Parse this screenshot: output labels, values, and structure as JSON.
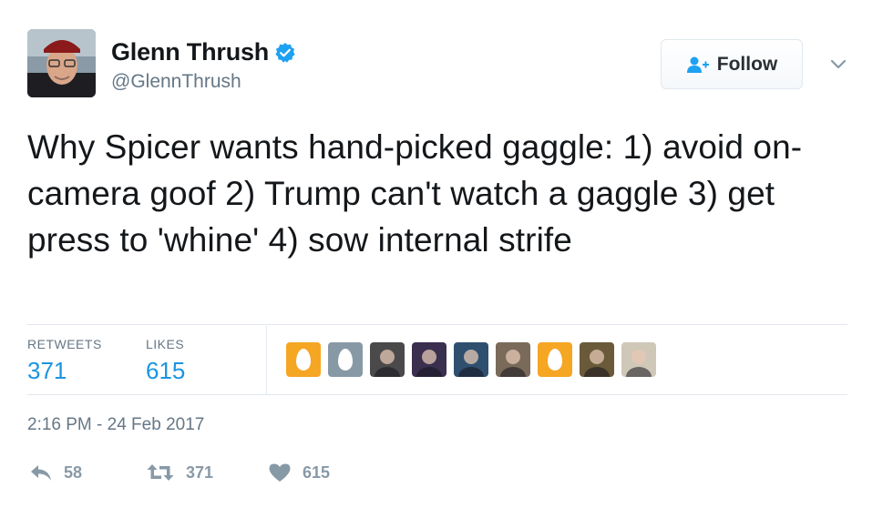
{
  "author": {
    "display_name": "Glenn Thrush",
    "handle": "@GlennThrush"
  },
  "follow_button": {
    "label": "Follow"
  },
  "tweet": {
    "text": "Why Spicer wants hand-picked gaggle: 1) avoid on-camera goof 2) Trump can't watch a gaggle 3) get press to 'whine' 4) sow internal strife",
    "timestamp": "2:16 PM - 24 Feb 2017"
  },
  "stats": {
    "retweets_label": "RETWEETS",
    "retweets_value": "371",
    "likes_label": "LIKES",
    "likes_value": "615"
  },
  "likers": [
    {
      "kind": "egg",
      "color": "#f5a623"
    },
    {
      "kind": "egg",
      "color": "#8899a6"
    },
    {
      "kind": "photo",
      "color": "#4a4a4a"
    },
    {
      "kind": "photo",
      "color": "#3a2f4f"
    },
    {
      "kind": "photo",
      "color": "#2f4f6f"
    },
    {
      "kind": "photo",
      "color": "#7a6a5a"
    },
    {
      "kind": "egg",
      "color": "#f5a623"
    },
    {
      "kind": "photo",
      "color": "#6a5a3a"
    },
    {
      "kind": "photo",
      "color": "#cfc7b8",
      "letter": "C"
    }
  ],
  "actions": {
    "reply_count": "58",
    "retweet_count": "371",
    "like_count": "615"
  },
  "colors": {
    "accent": "#1b95e0",
    "verified": "#1da1f2",
    "muted": "#657786"
  }
}
